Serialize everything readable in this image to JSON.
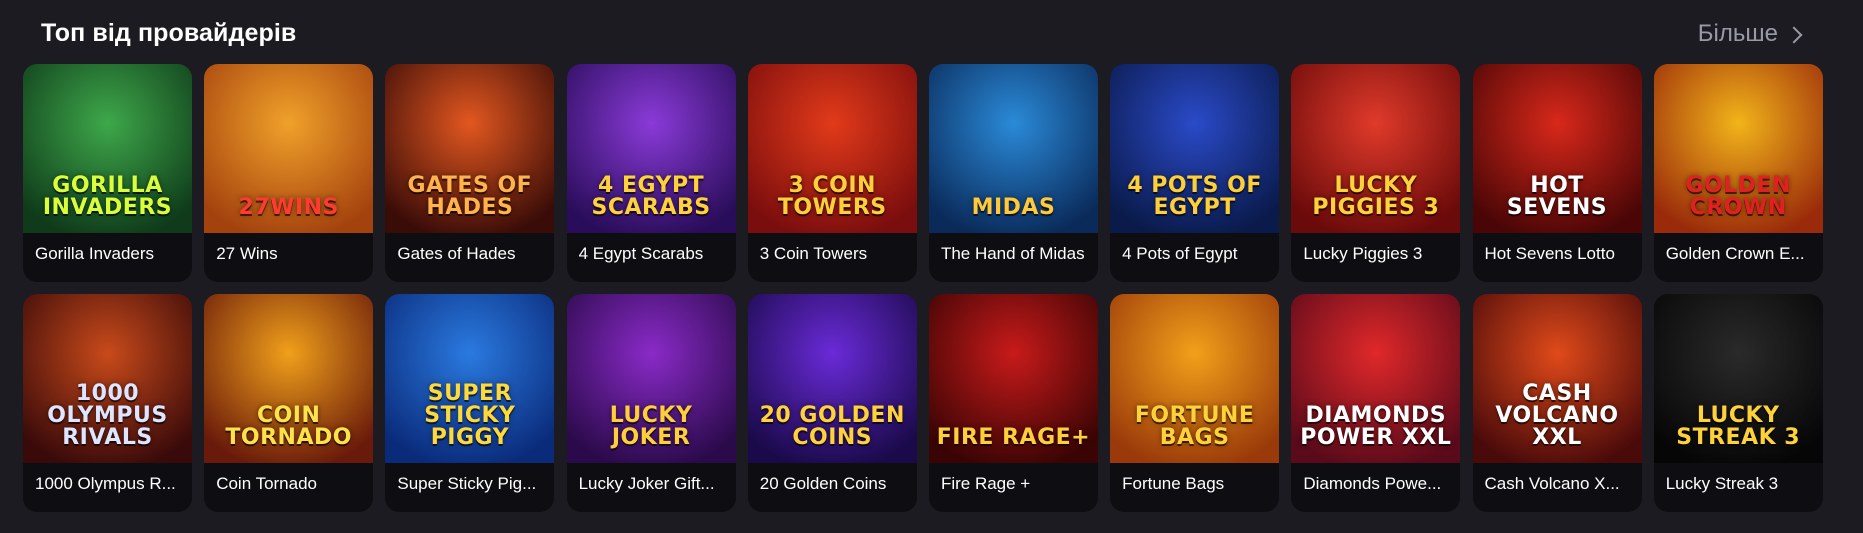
{
  "header": {
    "title": "Топ від провайдерів",
    "more_label": "Більше",
    "more_icon": "chevron-right-icon"
  },
  "games": [
    {
      "name": "Gorilla Invaders",
      "logo": "GORILLA INVADERS",
      "bg1": "#3ea84a",
      "bg2": "#0f3b1a",
      "logo_color": "#d9ff3a"
    },
    {
      "name": "27 Wins",
      "logo": "27wins",
      "bg1": "#f0a12a",
      "bg2": "#a4420e",
      "logo_color": "#ff3b2f"
    },
    {
      "name": "Gates of Hades",
      "logo": "GATES OF HADES",
      "bg1": "#e2571f",
      "bg2": "#3a0c08",
      "logo_color": "#ffb34a"
    },
    {
      "name": "4 Egypt Scarabs",
      "logo": "4 EGYPT SCARABS",
      "bg1": "#8a3ad8",
      "bg2": "#2a0d5a",
      "logo_color": "#ffd23a"
    },
    {
      "name": "3 Coin Towers",
      "logo": "3 COIN TOWERS",
      "bg1": "#e23a1a",
      "bg2": "#7a0d0d",
      "logo_color": "#ffcf3a"
    },
    {
      "name": "The Hand of Midas",
      "logo": "MIDAS",
      "bg1": "#2a8ad8",
      "bg2": "#0a2a5a",
      "logo_color": "#ffc93a"
    },
    {
      "name": "4 Pots of Egypt",
      "logo": "4 POTS OF EGYPT",
      "bg1": "#2a4ac8",
      "bg2": "#0a1a4a",
      "logo_color": "#ffcf3a"
    },
    {
      "name": "Lucky Piggies 3",
      "logo": "LUCKY PIGGIES 3",
      "bg1": "#e03a2a",
      "bg2": "#6a0a0a",
      "logo_color": "#ffd23a"
    },
    {
      "name": "Hot Sevens Lotto",
      "logo": "HOT SEVENS",
      "bg1": "#d8281a",
      "bg2": "#4a0606",
      "logo_color": "#ffffff"
    },
    {
      "name": "Golden Crown E...",
      "logo": "GOLDEN CROWN",
      "bg1": "#f2b41a",
      "bg2": "#9a2a0a",
      "logo_color": "#e22020"
    },
    {
      "name": "1000 Olympus R...",
      "logo": "1000 OLYMPUS RIVALS",
      "bg1": "#c84a1a",
      "bg2": "#3a0a0a",
      "logo_color": "#dfe4ff"
    },
    {
      "name": "Coin Tornado",
      "logo": "COIN TORNADO",
      "bg1": "#f0a01a",
      "bg2": "#6a1a0a",
      "logo_color": "#ffe14a"
    },
    {
      "name": "Super Sticky Pig...",
      "logo": "SUPER STICKY PIGGY",
      "bg1": "#2a7ae0",
      "bg2": "#0a2a7a",
      "logo_color": "#ffd83a"
    },
    {
      "name": "Lucky Joker Gift...",
      "logo": "LUCKY JOKER",
      "bg1": "#8a2ac8",
      "bg2": "#2a0a4a",
      "logo_color": "#ffcf3a"
    },
    {
      "name": "20 Golden Coins",
      "logo": "20 GOLDEN COINS",
      "bg1": "#6a2ad8",
      "bg2": "#1a0a4a",
      "logo_color": "#ffd23a"
    },
    {
      "name": "Fire Rage +",
      "logo": "Fire Rage+",
      "bg1": "#c81a1a",
      "bg2": "#3a0404",
      "logo_color": "#ffcf3a"
    },
    {
      "name": "Fortune Bags",
      "logo": "FORTUNE BAGS",
      "bg1": "#f2a01a",
      "bg2": "#9a3a0a",
      "logo_color": "#ffd23a"
    },
    {
      "name": "Diamonds Powe...",
      "logo": "DIAMONDS POWER XXL",
      "bg1": "#e0282a",
      "bg2": "#5a0a1a",
      "logo_color": "#ffffff"
    },
    {
      "name": "Cash Volcano X...",
      "logo": "CASH VOLCANO XXL",
      "bg1": "#e04a1a",
      "bg2": "#4a0a0a",
      "logo_color": "#ffffff"
    },
    {
      "name": "Lucky Streak 3",
      "logo": "Lucky Streak 3",
      "bg1": "#2a2a2a",
      "bg2": "#060606",
      "logo_color": "#ffd23a"
    }
  ]
}
